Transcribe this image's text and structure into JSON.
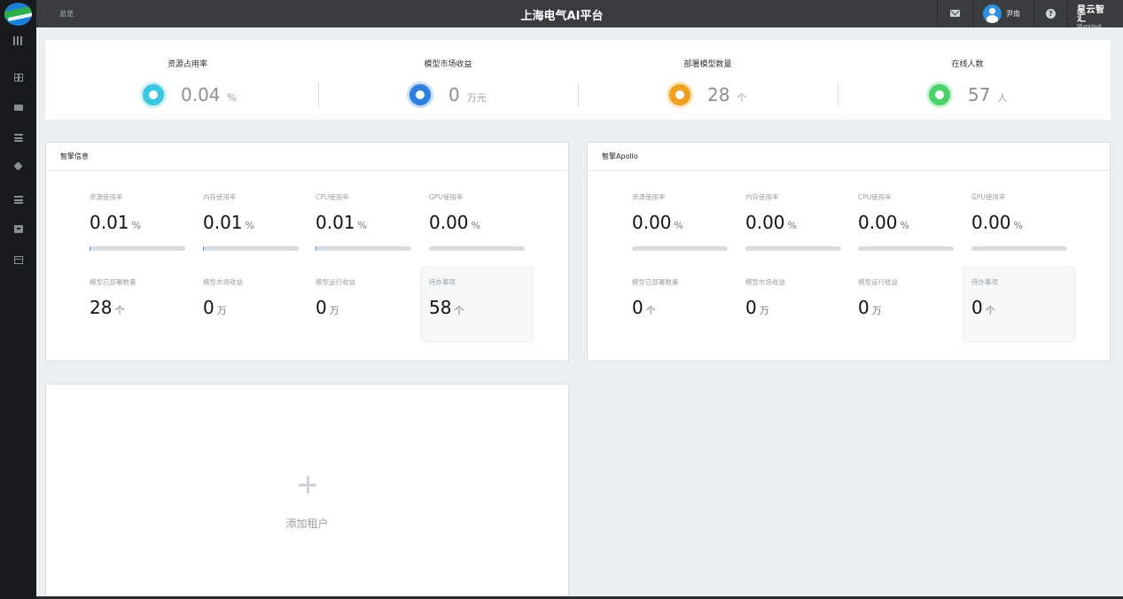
{
  "app": {
    "title": "上海电气AI平台",
    "breadcrumb": "总览"
  },
  "user": {
    "name": "尹南"
  },
  "brand": {
    "line1": "星云智汇",
    "line2": "SEunicloud"
  },
  "colors": {
    "sidebar": "#181a1d",
    "topbar": "#3a3c3f",
    "kpi_teal": "#3cc6e0",
    "kpi_blue": "#2f7fe0",
    "kpi_orange": "#f0a020",
    "kpi_green": "#4cd26a",
    "progress": "#4a90e2"
  },
  "sidebar": {
    "items": [
      {
        "icon": "grid-icon"
      },
      {
        "icon": "folder-icon"
      },
      {
        "icon": "database-icon"
      },
      {
        "icon": "cube-icon"
      },
      {
        "icon": "list-icon"
      },
      {
        "icon": "box-icon"
      },
      {
        "icon": "card-icon"
      }
    ]
  },
  "kpis": [
    {
      "label": "资源占用率",
      "value": "0.04",
      "unit": "%",
      "icon": "pie-chart-icon",
      "color": "#3cc6e0"
    },
    {
      "label": "模型市场收益",
      "value": "0",
      "unit": "万元",
      "icon": "money-bag-icon",
      "color": "#2f7fe0"
    },
    {
      "label": "部署模型数量",
      "value": "28",
      "unit": "个",
      "icon": "cube-icon",
      "color": "#f0a020"
    },
    {
      "label": "在线人数",
      "value": "57",
      "unit": "人",
      "icon": "user-icon",
      "color": "#4cd26a"
    }
  ],
  "panels": [
    {
      "title": "智擎信息",
      "usage": [
        {
          "label": "资源使用率",
          "value": "0.01",
          "unit": "%",
          "progress": 0.01
        },
        {
          "label": "内存使用率",
          "value": "0.01",
          "unit": "%",
          "progress": 0.01
        },
        {
          "label": "CPU使用率",
          "value": "0.01",
          "unit": "%",
          "progress": 0.01
        },
        {
          "label": "GPU使用率",
          "value": "0.00",
          "unit": "%",
          "progress": 0
        }
      ],
      "stats": [
        {
          "label": "模型已部署数量",
          "value": "28",
          "unit": "个"
        },
        {
          "label": "模型市场收益",
          "value": "0",
          "unit": "万"
        },
        {
          "label": "模型运行收益",
          "value": "0",
          "unit": "万"
        },
        {
          "label": "待办事项",
          "value": "58",
          "unit": "个"
        }
      ]
    },
    {
      "title": "智擎Apollo",
      "usage": [
        {
          "label": "资源使用率",
          "value": "0.00",
          "unit": "%",
          "progress": 0
        },
        {
          "label": "内存使用率",
          "value": "0.00",
          "unit": "%",
          "progress": 0
        },
        {
          "label": "CPU使用率",
          "value": "0.00",
          "unit": "%",
          "progress": 0
        },
        {
          "label": "GPU使用率",
          "value": "0.00",
          "unit": "%",
          "progress": 0
        }
      ],
      "stats": [
        {
          "label": "模型已部署数量",
          "value": "0",
          "unit": "个"
        },
        {
          "label": "模型市场收益",
          "value": "0",
          "unit": "万"
        },
        {
          "label": "模型运行收益",
          "value": "0",
          "unit": "万"
        },
        {
          "label": "待办事项",
          "value": "0",
          "unit": "个"
        }
      ]
    }
  ],
  "add_tenant": {
    "label": "添加租户"
  }
}
